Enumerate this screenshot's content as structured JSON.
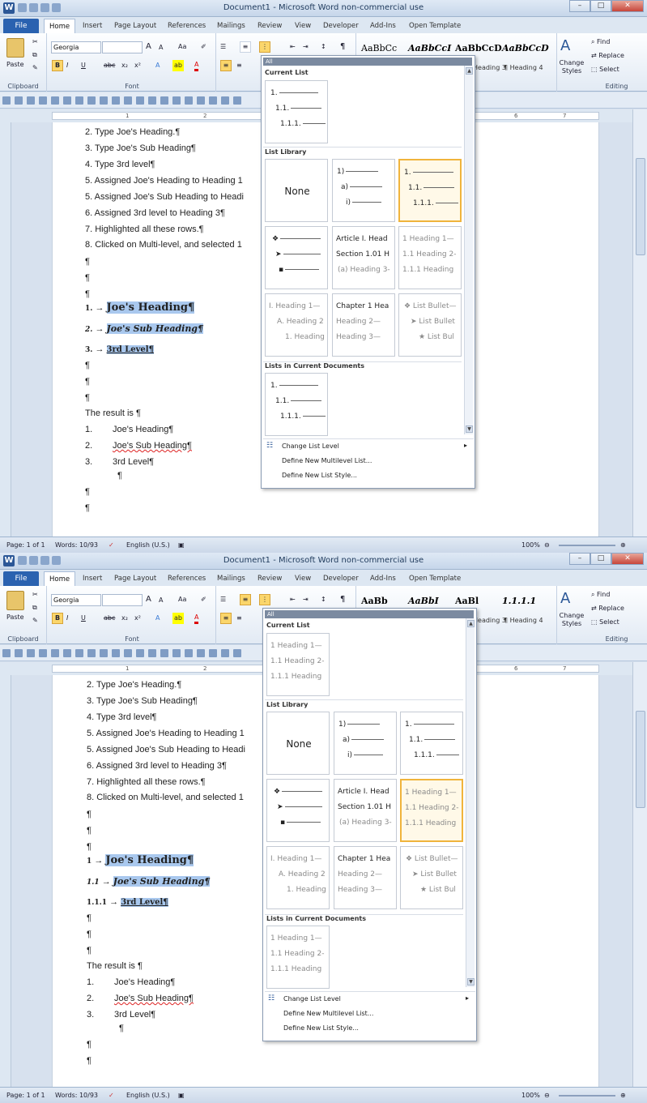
{
  "app": {
    "title": "Document1 - Microsoft Word non-commercial use",
    "qat_icons": [
      "save-icon",
      "undo-icon",
      "redo-icon",
      "print-icon"
    ],
    "window_buttons": {
      "minimize": "–",
      "maximize": "□",
      "close": "✕"
    }
  },
  "tabs": [
    "File",
    "Home",
    "Insert",
    "Page Layout",
    "References",
    "Mailings",
    "Review",
    "View",
    "Developer",
    "Add-Ins",
    "Open Template"
  ],
  "ribbon": {
    "clipboard_label": "Clipboard",
    "paste_label": "Paste",
    "font_label": "Font",
    "font_name": "Georgia",
    "font_size": "",
    "bold": "B",
    "italic": "I",
    "underline": "U",
    "strike": "abc",
    "subscript": "x₂",
    "superscript": "x²",
    "grow_font": "A",
    "shrink_font": "A",
    "change_case": "Aa",
    "styles_label": "Styles",
    "change_styles_label": "Change Styles",
    "editing_label": "Editing",
    "find_label": "Find",
    "replace_label": "Replace",
    "select_label": "Select",
    "pilcrow": "¶"
  },
  "ruler_numbers": [
    "1",
    "2",
    "3",
    "4",
    "5",
    "6",
    "7"
  ],
  "document": {
    "lines": [
      "2. Type Joe's Heading.¶",
      "3. Type Joe's Sub Heading¶",
      "4. Type 3rd level¶",
      "5. Assigned Joe's Heading to Heading 1",
      "5. Assigned Joe's Sub Heading to Headi",
      "6. Assigned 3rd level to Heading 3¶",
      "7. Highlighted all these rows.¶",
      "8. Clicked on Multi-level, and selected 1"
    ],
    "pilcrow": "¶",
    "headings": [
      "Joe's Heading¶",
      "Joe's Sub Heading¶",
      "3rd Level¶"
    ],
    "result_label": "The result is ¶",
    "result_items": [
      {
        "num": "1.",
        "text": "Joe's Heading¶"
      },
      {
        "num": "2.",
        "text": "Joe's Sub Heading¶"
      },
      {
        "num": "3.",
        "text": "3rd Level¶"
      }
    ]
  },
  "screens": [
    {
      "style_previews": [
        "AaBbCc",
        "AaBbCcI",
        "AaBbCcD",
        "AaBbCcD"
      ],
      "style_names": [
        "Heading 3",
        "¶ Heading 4"
      ],
      "heading_numbers": [
        "1.",
        "2.",
        "3."
      ],
      "current_list": {
        "lines": [
          "1.",
          "1.1.",
          "1.1.1."
        ],
        "grey": false
      }
    },
    {
      "style_previews": [
        "AaBb",
        "AaBbI",
        "AaBl",
        "1.1.1.1"
      ],
      "style_names": [
        "Heading 3",
        "¶ Heading 4"
      ],
      "heading_numbers": [
        "1",
        "1.1",
        "1.1.1"
      ],
      "current_list": {
        "lines": [
          "1 Heading 1—",
          "1.1 Heading 2-",
          "1.1.1 Heading"
        ],
        "grey": true
      }
    }
  ],
  "menu": {
    "all_label": "All",
    "current_list_header": "Current List",
    "list_library_header": "List Library",
    "lists_in_doc_header": "Lists in Current Documents",
    "tile_none": "None",
    "tile_paren": [
      "1)",
      "a)",
      "i)"
    ],
    "tile_numbered": [
      "1.",
      "1.1.",
      "1.1.1."
    ],
    "tile_bullets": [
      "❖",
      "➤",
      "▪"
    ],
    "tile_article": [
      "Article I. Head",
      "Section 1.01 H",
      "(a) Heading 3-"
    ],
    "tile_heading_num": [
      "1 Heading 1—",
      "1.1 Heading 2-",
      "1.1.1 Heading"
    ],
    "tile_roman": [
      "I. Heading 1—",
      "A. Heading 2",
      "1. Heading"
    ],
    "tile_chapter": [
      "Chapter 1 Hea",
      "Heading 2—",
      "Heading 3—"
    ],
    "tile_list_bullet": [
      "❖ List Bullet—",
      "➤ List Bullet",
      "★ List Bul"
    ],
    "change_level": "Change List Level",
    "define_multilevel": "Define New Multilevel List...",
    "define_style": "Define New List Style..."
  },
  "status": {
    "page": "Page: 1 of 1",
    "words": "Words: 10/93",
    "language": "English (U.S.)",
    "zoom": "100%"
  }
}
